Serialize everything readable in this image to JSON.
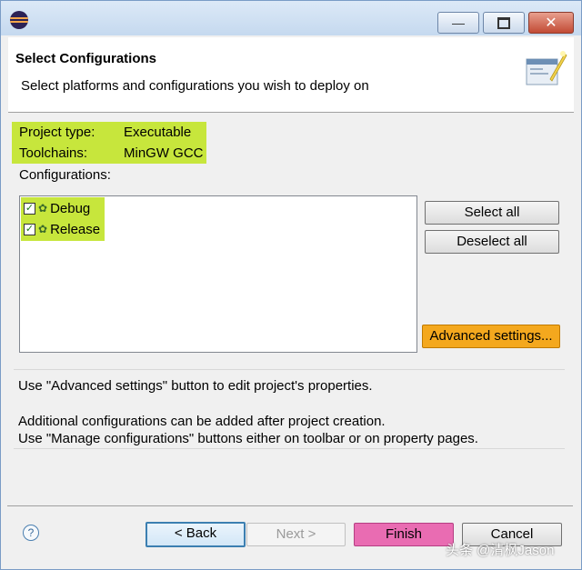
{
  "header": {
    "title": "Select Configurations",
    "description": "Select platforms and configurations you wish to deploy on"
  },
  "project": {
    "type_label": "Project type:",
    "type_value": "Executable",
    "toolchain_label": "Toolchains:",
    "toolchain_value": "MinGW GCC",
    "configurations_label": "Configurations:"
  },
  "configurations": [
    {
      "name": "Debug",
      "checked": true
    },
    {
      "name": "Release",
      "checked": true
    }
  ],
  "buttons": {
    "select_all": "Select all",
    "deselect_all": "Deselect all",
    "advanced": "Advanced settings...",
    "back": "< Back",
    "next": "Next >",
    "finish": "Finish",
    "cancel": "Cancel"
  },
  "info": {
    "line1": "Use \"Advanced settings\" button to edit project's properties.",
    "line2": "Additional configurations can be added after project creation.",
    "line3": "Use \"Manage configurations\" buttons either on toolbar or on property pages."
  },
  "help_glyph": "?",
  "watermark": "头条 @清枫Jason",
  "colors": {
    "highlight_green": "#c7e63c",
    "advanced_orange": "#f4a81e",
    "finish_pink": "#e96cb2"
  }
}
